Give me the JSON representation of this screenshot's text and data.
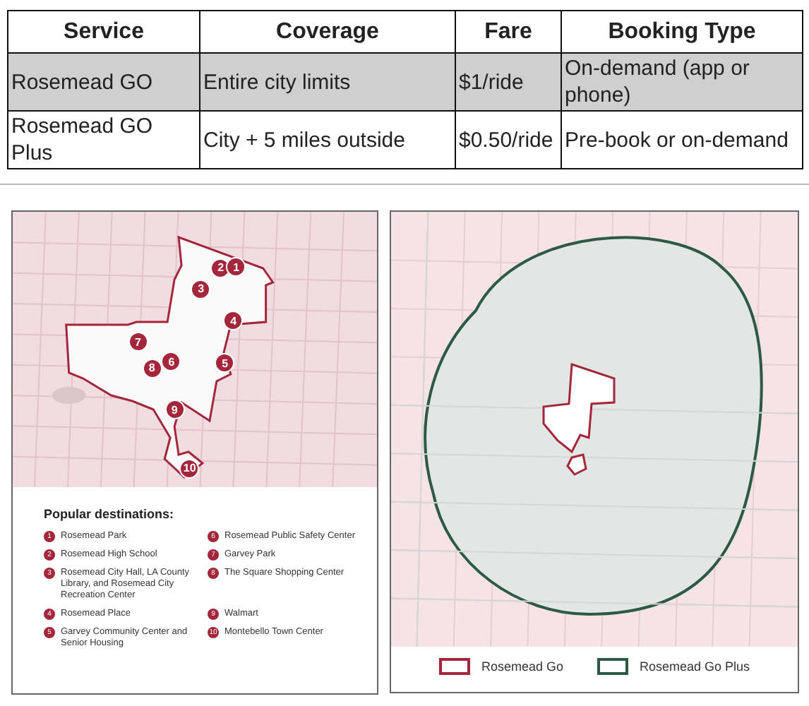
{
  "table": {
    "columns": [
      "Service",
      "Coverage",
      "Fare",
      "Booking Type"
    ],
    "rows": [
      {
        "cells": [
          "Rosemead GO",
          "Entire city limits",
          "$1/ride",
          "On-demand (app or phone)"
        ],
        "shaded": true
      },
      {
        "cells": [
          "Rosemead GO Plus",
          "City + 5 miles outside",
          "$0.50/ride",
          "Pre-book or on-demand"
        ],
        "shaded": false
      }
    ]
  },
  "left_map": {
    "kind": "picture",
    "markers": [
      "2",
      "1",
      "3",
      "4",
      "7",
      "8",
      "6",
      "5",
      "9",
      "10"
    ],
    "legend_title": "Popular destinations:",
    "destinations": [
      {
        "num": "1",
        "name": "Rosemead Park"
      },
      {
        "num": "2",
        "name": "Rosemead High School"
      },
      {
        "num": "3",
        "name": "Rosemead City Hall, LA County Library, and Rosemead City Recreation Center"
      },
      {
        "num": "4",
        "name": "Rosemead Place"
      },
      {
        "num": "5",
        "name": "Garvey Community Center and Senior Housing"
      },
      {
        "num": "6",
        "name": "Rosemead Public Safety Center"
      },
      {
        "num": "7",
        "name": "Garvey Park"
      },
      {
        "num": "8",
        "name": "The Square Shopping Center"
      },
      {
        "num": "9",
        "name": "Walmart"
      },
      {
        "num": "10",
        "name": "Montebello Town Center"
      }
    ]
  },
  "right_map": {
    "kind": "picture",
    "legend": [
      {
        "label": "Rosemead Go",
        "color": "#a3263b"
      },
      {
        "label": "Rosemead Go Plus",
        "color": "#2d5a45"
      }
    ]
  }
}
